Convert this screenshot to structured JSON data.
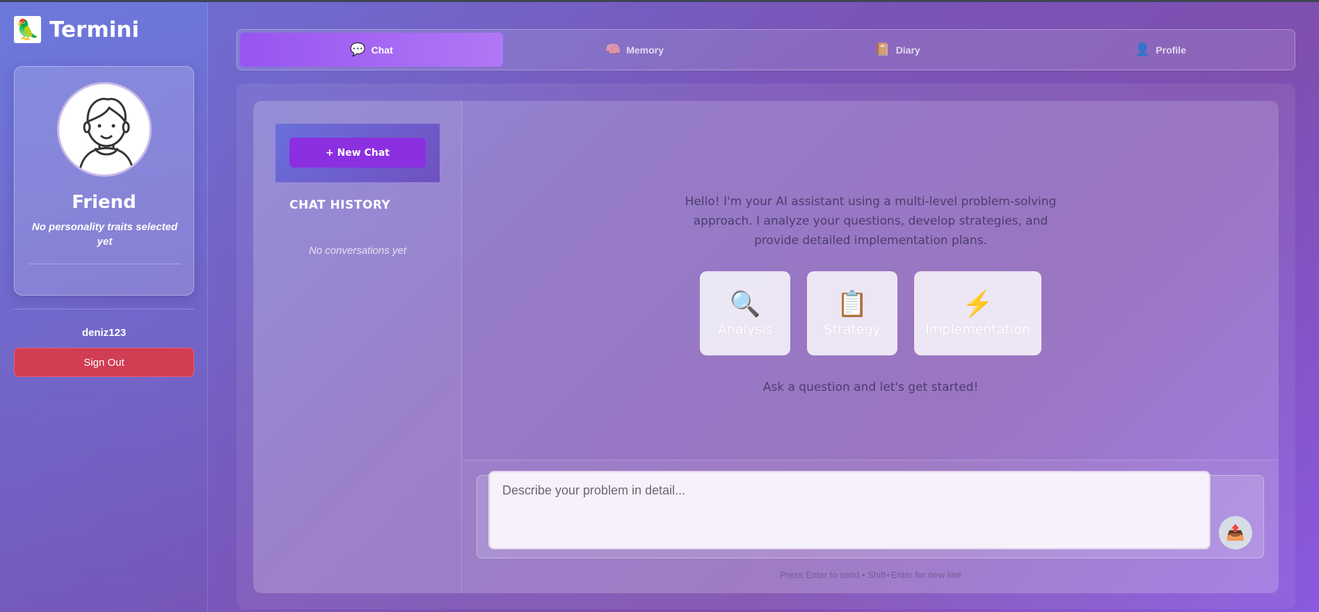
{
  "app": {
    "name": "Termini",
    "logo_icon": "🦜"
  },
  "profile": {
    "name": "Friend",
    "traits_text": "No personality traits selected yet",
    "username": "deniz123",
    "signout_label": "Sign Out"
  },
  "tabs": [
    {
      "label": "Chat",
      "icon": "💬",
      "active": true
    },
    {
      "label": "Memory",
      "icon": "🧠",
      "active": false
    },
    {
      "label": "Diary",
      "icon": "📔",
      "active": false
    },
    {
      "label": "Profile",
      "icon": "👤",
      "active": false
    }
  ],
  "history": {
    "new_chat_label": "+ New Chat",
    "title": "CHAT HISTORY",
    "empty_text": "No conversations yet"
  },
  "welcome": {
    "message": "Hello! I'm your AI assistant using a multi-level problem-solving approach. I analyze your questions, develop strategies, and provide detailed implementation plans.",
    "cards": [
      {
        "label": "Analysis",
        "icon": "🔍"
      },
      {
        "label": "Strategy",
        "icon": "📋"
      },
      {
        "label": "Implementation",
        "icon": "⚡"
      }
    ],
    "prompt": "Ask a question and let's get started!"
  },
  "composer": {
    "placeholder": "Describe your problem in detail...",
    "send_icon": "📤",
    "hint": "Press Enter to send • Shift+Enter for new line"
  }
}
